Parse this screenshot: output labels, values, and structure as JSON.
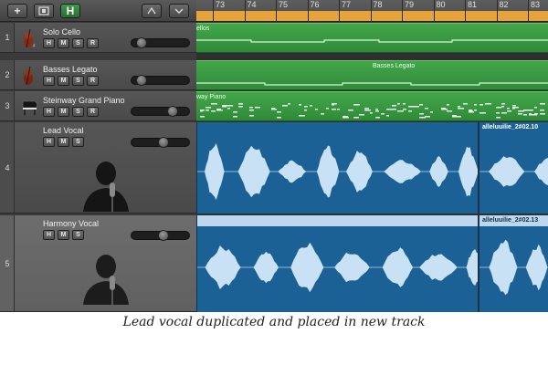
{
  "toolbar": {
    "add_icon": "plus-icon",
    "media_icon": "media-browser-icon",
    "smart_controls_label": "H",
    "flex_icon": "flex-icon",
    "dropdown_icon": "chevron-down-icon"
  },
  "ruler": {
    "bars": [
      "73",
      "74",
      "75",
      "76",
      "77",
      "78",
      "79",
      "80",
      "81",
      "82",
      "83"
    ]
  },
  "tracks": [
    {
      "number": "1",
      "name": "Solo Cello",
      "icon": "cello-icon",
      "buttons": [
        "H",
        "M",
        "S",
        "R"
      ],
      "volume": 0.1
    },
    {
      "number": "2",
      "name": "Basses Legato",
      "icon": "double-bass-icon",
      "buttons": [
        "H",
        "M",
        "S",
        "R"
      ],
      "volume": 0.1
    },
    {
      "number": "3",
      "name": "Steinway Grand Piano",
      "icon": "grand-piano-icon",
      "buttons": [
        "H",
        "M",
        "S",
        "R"
      ],
      "volume": 0.75
    },
    {
      "number": "4",
      "name": "Lead Vocal",
      "icon": "singer-icon",
      "buttons": [
        "H",
        "M",
        "S"
      ],
      "volume": 0.55
    },
    {
      "number": "5",
      "name": "Harmony Vocal",
      "icon": "singer-icon",
      "buttons": [
        "H",
        "M",
        "S"
      ],
      "volume": 0.55
    }
  ],
  "regions": {
    "cello": "ellos",
    "basses": "Basses Legato",
    "piano": "way Piano",
    "lead_vocal_tail": "alleluuilie_2#02.10",
    "harmony_vocal_tail": "alleluuilie_2#02.13"
  },
  "caption": "Lead vocal duplicated and placed in new track"
}
